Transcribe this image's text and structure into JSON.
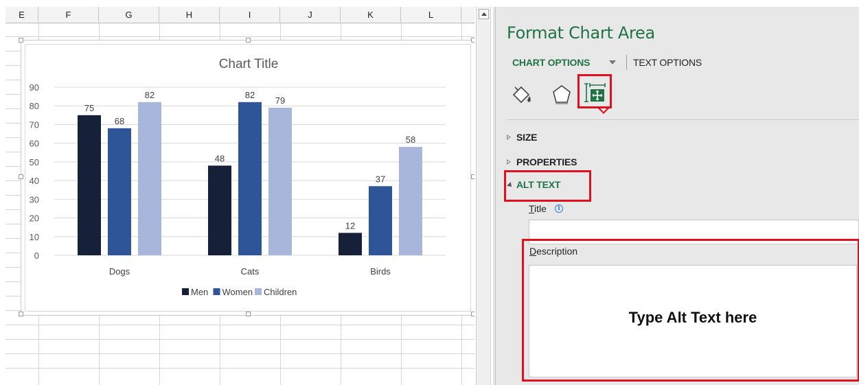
{
  "spreadsheet": {
    "columns": [
      "E",
      "F",
      "G",
      "H",
      "I",
      "J",
      "K",
      "L"
    ]
  },
  "chart_data": {
    "type": "bar",
    "title": "Chart Title",
    "categories": [
      "Dogs",
      "Cats",
      "Birds"
    ],
    "series": [
      {
        "name": "Men",
        "values": [
          75,
          48,
          12
        ],
        "color": "#162038"
      },
      {
        "name": "Women",
        "values": [
          68,
          82,
          37
        ],
        "color": "#2d5597"
      },
      {
        "name": "Children",
        "values": [
          82,
          79,
          58
        ],
        "color": "#a9b6dc"
      }
    ],
    "ylim": [
      0,
      90
    ],
    "yticks": [
      0,
      10,
      20,
      30,
      40,
      50,
      60,
      70,
      80,
      90
    ],
    "grid": true,
    "legend_position": "bottom",
    "data_labels": true
  },
  "pane": {
    "title": "Format Chart Area",
    "tabs": {
      "chart_options": "CHART OPTIONS",
      "text_options": "TEXT OPTIONS"
    },
    "icons": [
      "fill-line-icon",
      "effects-icon",
      "size-properties-icon"
    ],
    "sections": {
      "size": "SIZE",
      "properties": "PROPERTIES",
      "alt_text": "ALT TEXT"
    },
    "alt_text": {
      "title_label_first": "T",
      "title_label_rest": "itle",
      "title_value": "",
      "description_label_first": "D",
      "description_label_rest": "escription",
      "description_value": "Type Alt Text here"
    }
  },
  "colors": {
    "accent": "#217346",
    "highlight": "#e0111f"
  }
}
